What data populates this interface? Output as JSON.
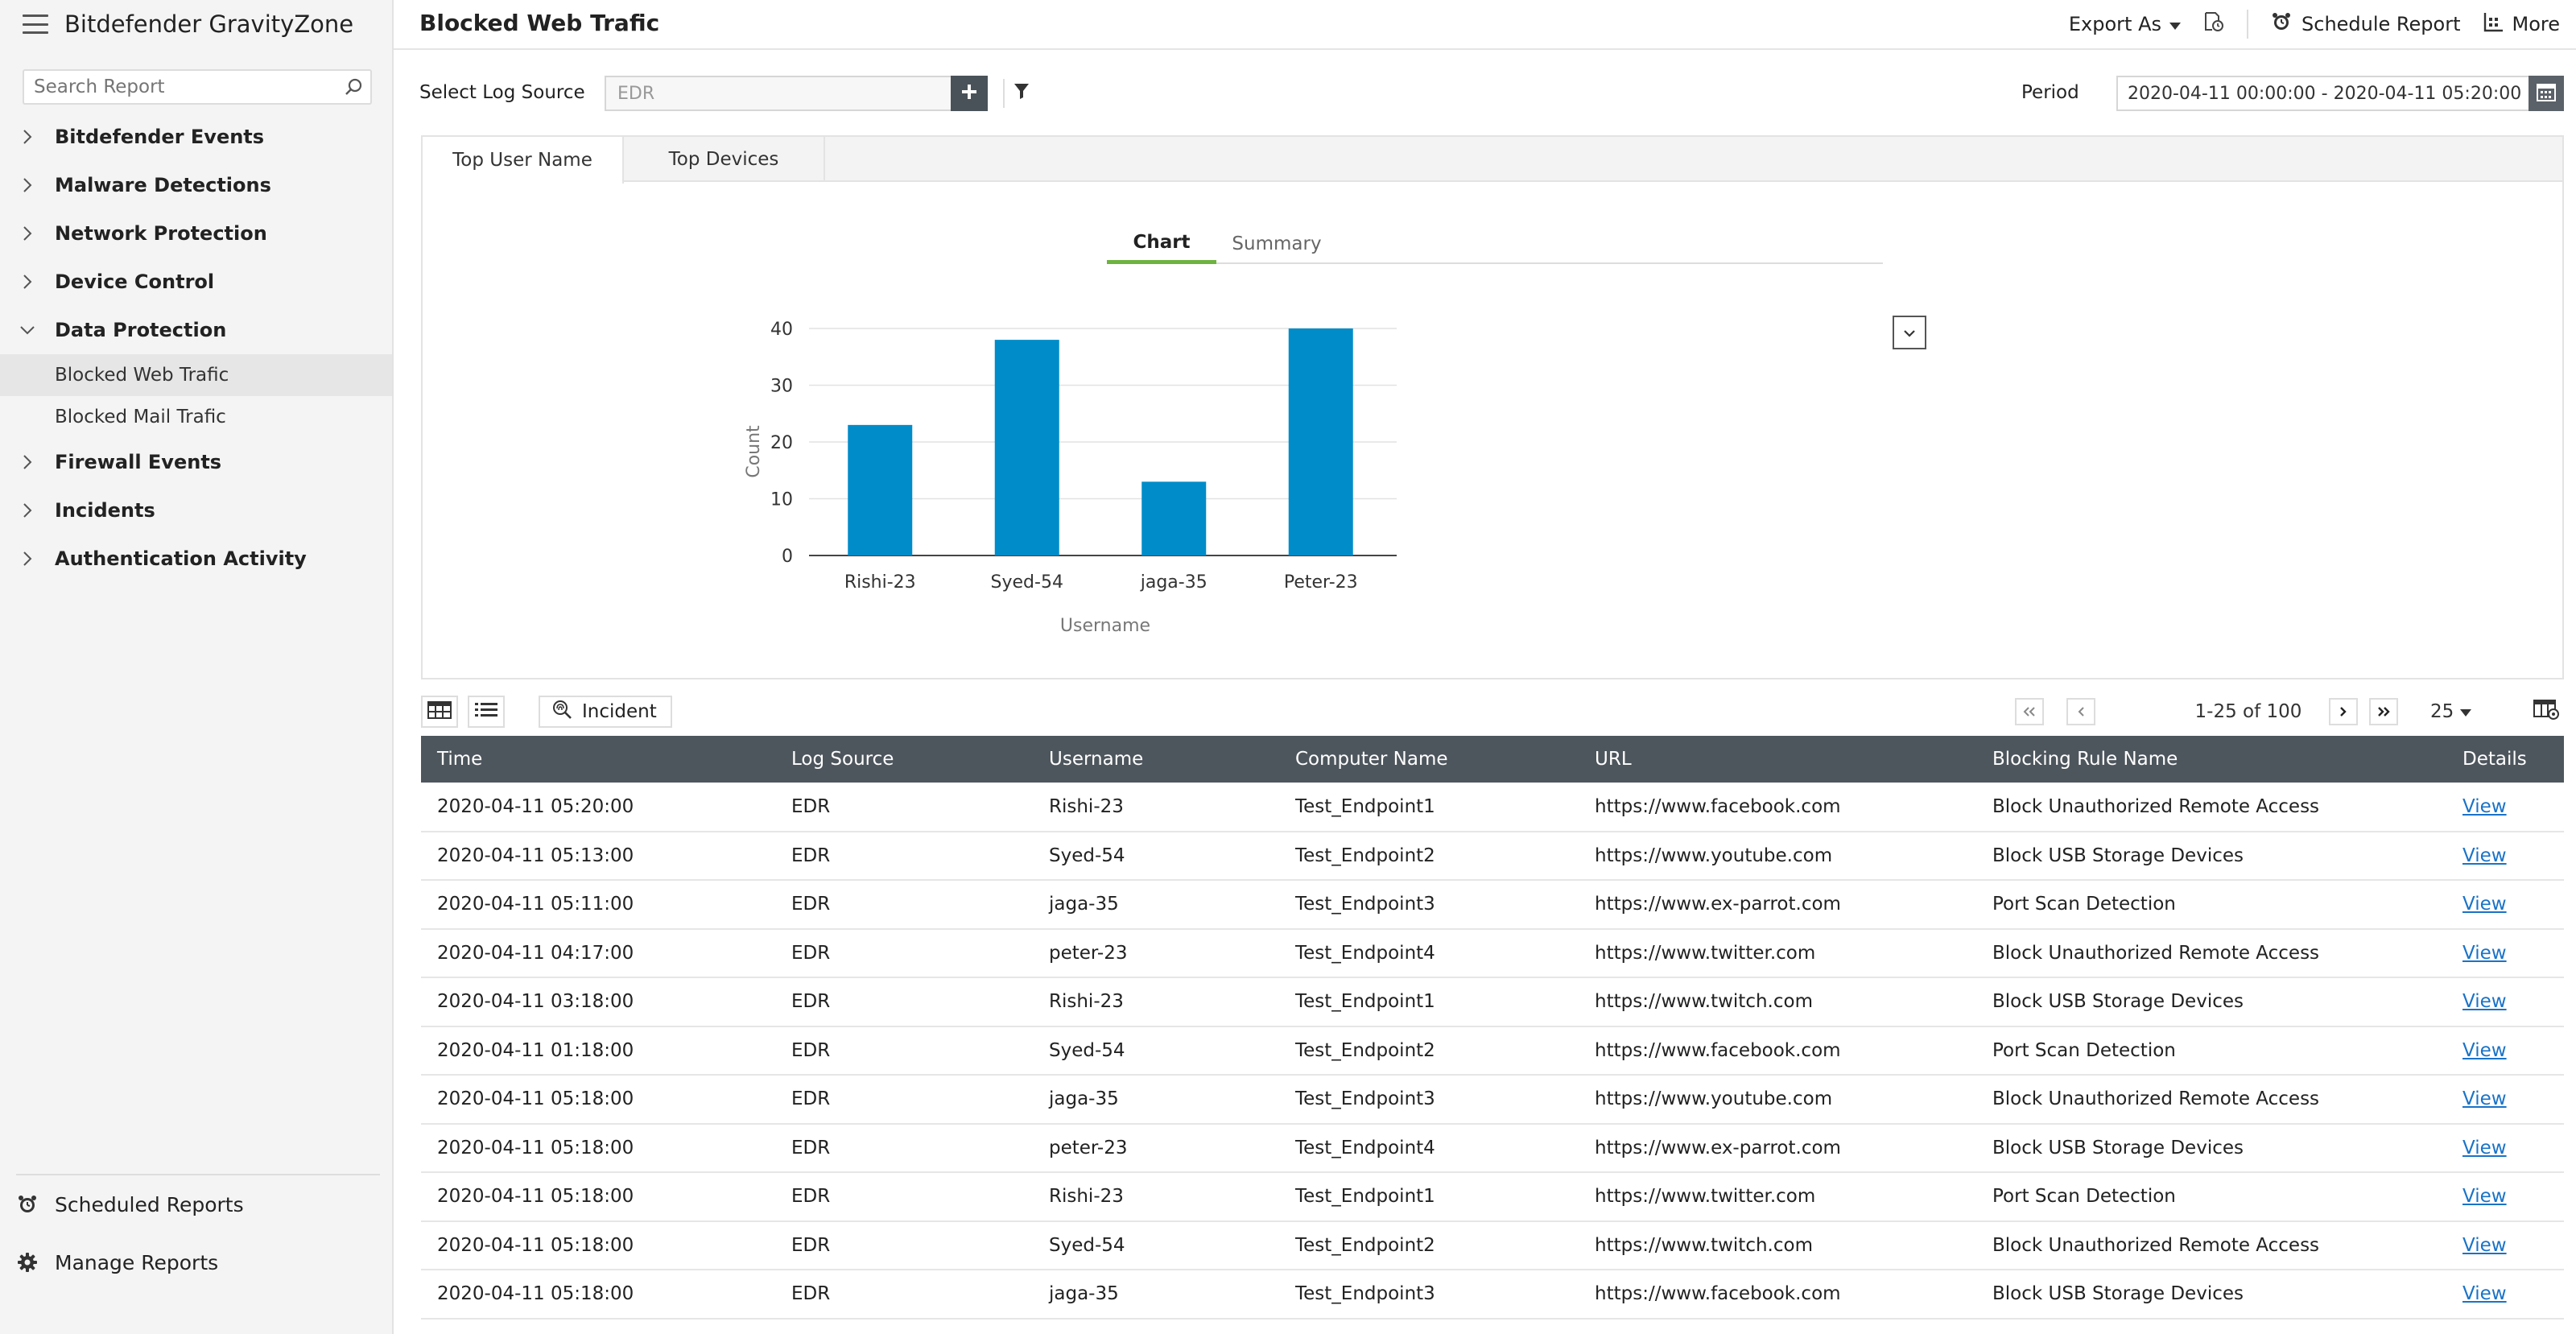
{
  "app": {
    "brand": "Bitdefender GravityZone"
  },
  "sidebar": {
    "search_placeholder": "Search Report",
    "items": [
      {
        "label": "Bitdefender  Events",
        "expanded": false
      },
      {
        "label": "Malware Detections",
        "expanded": false
      },
      {
        "label": "Network Protection",
        "expanded": false
      },
      {
        "label": "Device Control",
        "expanded": false
      },
      {
        "label": "Data Protection",
        "expanded": true
      },
      {
        "label": "Firewall Events",
        "expanded": false
      },
      {
        "label": "Incidents",
        "expanded": false
      },
      {
        "label": "Authentication Activity",
        "expanded": false
      }
    ],
    "subitems": [
      {
        "label": "Blocked Web Trafic",
        "active": true
      },
      {
        "label": "Blocked Mail Trafic",
        "active": false
      }
    ],
    "bottom": {
      "scheduled_reports": "Scheduled Reports",
      "manage_reports": "Manage Reports"
    }
  },
  "header": {
    "title": "Blocked Web Trafic",
    "export_as": "Export As",
    "schedule_report": "Schedule Report",
    "more": "More"
  },
  "filters": {
    "log_source_label": "Select Log Source",
    "log_source_value": "EDR",
    "period_label": "Period",
    "period_value": "2020-04-11 00:00:00 - 2020-04-11 05:20:00"
  },
  "panel_tabs": [
    "Top User Name",
    "Top Devices"
  ],
  "chart_tabs": [
    "Chart",
    "Summary"
  ],
  "chart_data": {
    "type": "bar",
    "categories": [
      "Rishi-23",
      "Syed-54",
      "jaga-35",
      "Peter-23"
    ],
    "values": [
      23,
      38,
      13,
      40
    ],
    "xlabel": "Username",
    "ylabel": "Count",
    "ylim": [
      0,
      40
    ],
    "yticks": [
      0,
      10,
      20,
      30,
      40
    ],
    "color": "#008cc9",
    "grid": true
  },
  "table_toolbar": {
    "incident_label": "Incident",
    "page_info": "1-25 of 100",
    "page_size": "25"
  },
  "table": {
    "columns": [
      "Time",
      "Log Source",
      "Username",
      "Computer Name",
      "URL",
      "Blocking Rule Name",
      "Details"
    ],
    "rows": [
      [
        "2020-04-11 05:20:00",
        "EDR",
        "Rishi-23",
        "Test_Endpoint1",
        "https://www.facebook.com",
        "Block Unauthorized Remote Access",
        "View"
      ],
      [
        "2020-04-11 05:13:00",
        "EDR",
        "Syed-54",
        "Test_Endpoint2",
        "https://www.youtube.com",
        "Block USB Storage Devices",
        "View"
      ],
      [
        "2020-04-11 05:11:00",
        "EDR",
        "jaga-35",
        "Test_Endpoint3",
        "https://www.ex-parrot.com",
        "Port Scan Detection",
        "View"
      ],
      [
        "2020-04-11 04:17:00",
        "EDR",
        "peter-23",
        "Test_Endpoint4",
        "https://www.twitter.com",
        "Block Unauthorized Remote Access",
        "View"
      ],
      [
        "2020-04-11 03:18:00",
        "EDR",
        "Rishi-23",
        "Test_Endpoint1",
        "https://www.twitch.com",
        "Block USB Storage Devices",
        "View"
      ],
      [
        "2020-04-11 01:18:00",
        "EDR",
        "Syed-54",
        "Test_Endpoint2",
        "https://www.facebook.com",
        "Port Scan Detection",
        "View"
      ],
      [
        "2020-04-11 05:18:00",
        "EDR",
        "jaga-35",
        "Test_Endpoint3",
        "https://www.youtube.com",
        "Block Unauthorized Remote Access",
        "View"
      ],
      [
        "2020-04-11 05:18:00",
        "EDR",
        "peter-23",
        "Test_Endpoint4",
        "https://www.ex-parrot.com",
        "Block USB Storage Devices",
        "View"
      ],
      [
        "2020-04-11 05:18:00",
        "EDR",
        "Rishi-23",
        "Test_Endpoint1",
        "https://www.twitter.com",
        "Port Scan Detection",
        "View"
      ],
      [
        "2020-04-11 05:18:00",
        "EDR",
        "Syed-54",
        "Test_Endpoint2",
        "https://www.twitch.com",
        "Block Unauthorized Remote Access",
        "View"
      ],
      [
        "2020-04-11 05:18:00",
        "EDR",
        "jaga-35",
        "Test_Endpoint3",
        "https://www.facebook.com",
        "Block USB Storage Devices",
        "View"
      ]
    ]
  }
}
